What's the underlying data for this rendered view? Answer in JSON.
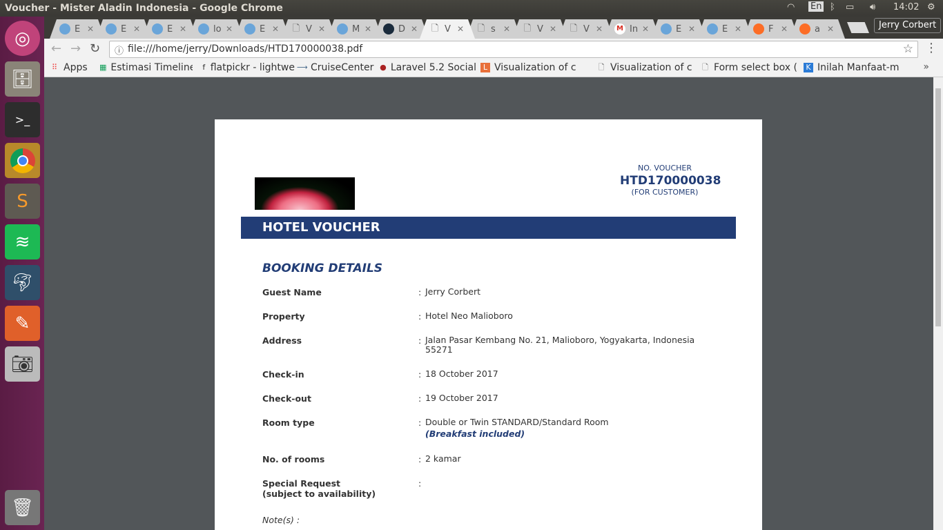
{
  "system": {
    "window_title": "Voucher - Mister Aladin Indonesia - Google Chrome",
    "keyboard": "En",
    "clock": "14:02",
    "user": "Jerry Corbert"
  },
  "launcher": [
    "ubuntu-dash",
    "files",
    "terminal",
    "chrome",
    "sublime-text",
    "spotify",
    "mysql-workbench",
    "postman",
    "screenshot",
    "trash"
  ],
  "tabs": [
    {
      "label": "E"
    },
    {
      "label": "E"
    },
    {
      "label": "E"
    },
    {
      "label": "lo"
    },
    {
      "label": "E"
    },
    {
      "label": "V"
    },
    {
      "label": "M"
    },
    {
      "label": "D"
    },
    {
      "label": "V",
      "active": true
    },
    {
      "label": "s"
    },
    {
      "label": "V"
    },
    {
      "label": "V"
    },
    {
      "label": "In"
    },
    {
      "label": "E"
    },
    {
      "label": "E"
    },
    {
      "label": "F"
    },
    {
      "label": "a"
    }
  ],
  "toolbar": {
    "url": "file:///home/jerry/Downloads/HTD170000038.pdf"
  },
  "bookmarks": [
    "Apps",
    "Estimasi Timeline",
    "flatpickr - lightwe",
    "CruiseCenter",
    "Laravel 5.2 Social",
    "Visualization of c",
    "Visualization of c",
    "Form select box (",
    "Inilah Manfaat-m"
  ],
  "voucher": {
    "no_label": "NO. VOUCHER",
    "number": "HTD170000038",
    "for": "(FOR CUSTOMER)",
    "banner": "HOTEL VOUCHER",
    "section": "BOOKING DETAILS",
    "rows": [
      {
        "k": "Guest Name",
        "v": "Jerry Corbert"
      },
      {
        "k": "Property",
        "v": "Hotel Neo Malioboro"
      },
      {
        "k": "Address",
        "v": "Jalan Pasar Kembang No. 21, Malioboro, Yogyakarta, Indonesia 55271"
      },
      {
        "k": "Check-in",
        "v": "18 October 2017"
      },
      {
        "k": "Check-out",
        "v": "19 October 2017"
      },
      {
        "k": "Room type",
        "v": "Double or Twin STANDARD/Standard Room",
        "sub": "(Breakfast included)"
      },
      {
        "k": "No. of rooms",
        "v": "2 kamar"
      },
      {
        "k": "Special Request",
        "k2": "(subject to availability)",
        "v": ""
      }
    ],
    "colon": ":",
    "notes": "Note(s) :"
  }
}
